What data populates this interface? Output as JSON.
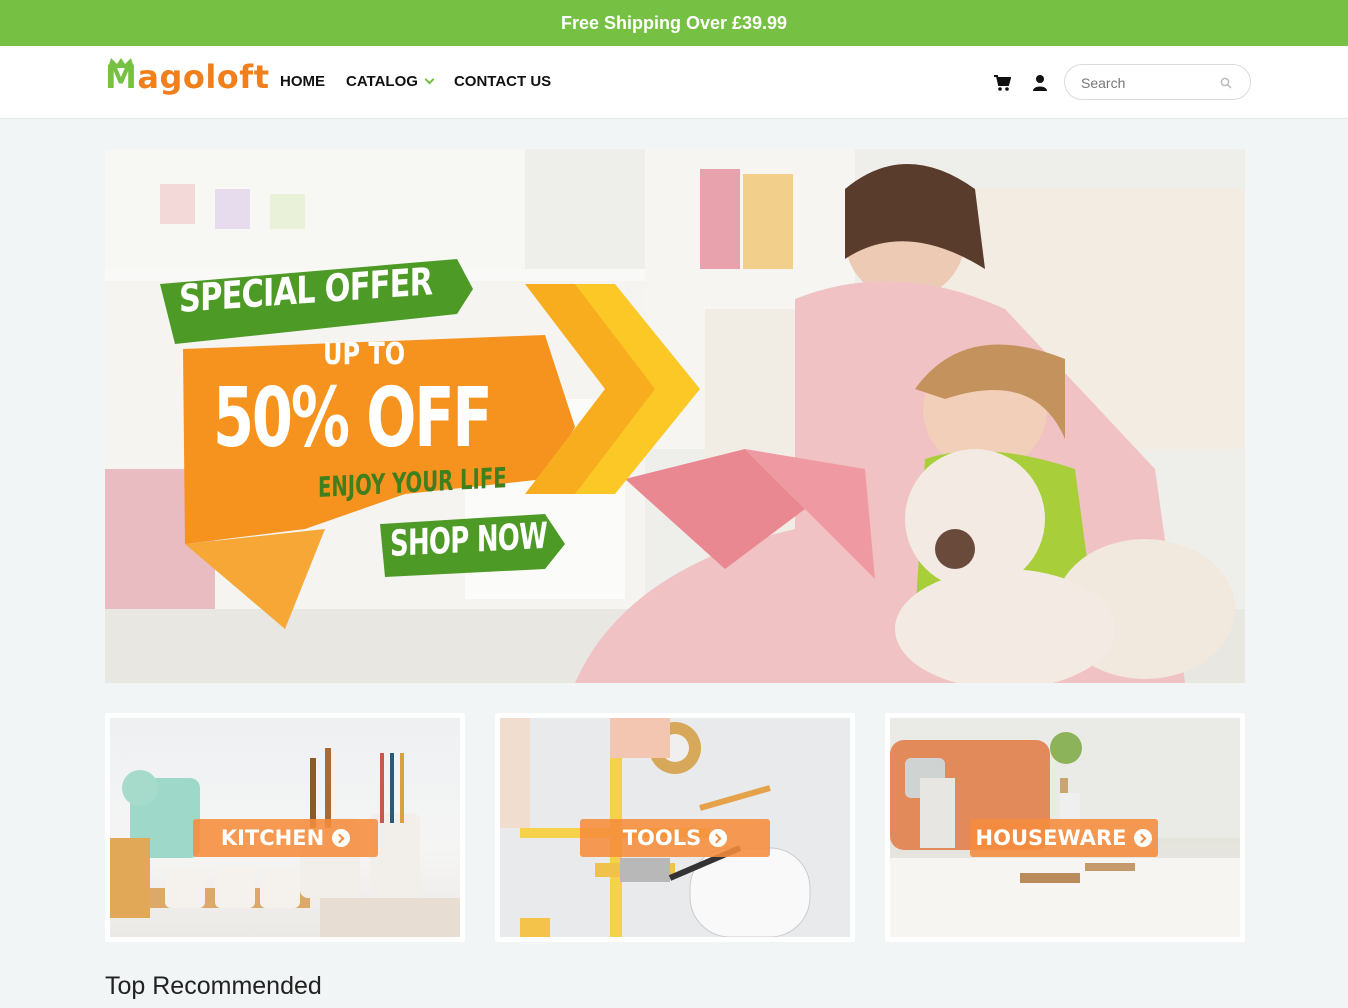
{
  "announcement": {
    "text": "Free Shipping Over £39.99"
  },
  "header": {
    "logo_text": "Magoloft",
    "nav": [
      {
        "label": "HOME"
      },
      {
        "label": "CATALOG",
        "has_dropdown": true
      },
      {
        "label": "CONTACT US"
      }
    ],
    "search_placeholder": "Search",
    "icons": [
      "cart-icon",
      "user-icon",
      "search-icon"
    ]
  },
  "hero": {
    "headline": "SPECIAL OFFER",
    "upto": "UP TO",
    "discount": "50% OFF",
    "tagline": "ENJOY YOUR LIFE",
    "cta": "SHOP NOW"
  },
  "categories": [
    {
      "label": "KITCHEN"
    },
    {
      "label": "TOOLS"
    },
    {
      "label": "HOUSEWARE"
    }
  ],
  "sections": {
    "top_recommended": "Top Recommended"
  },
  "colors": {
    "brand_green": "#76c043",
    "brand_orange": "#f07f1c"
  }
}
